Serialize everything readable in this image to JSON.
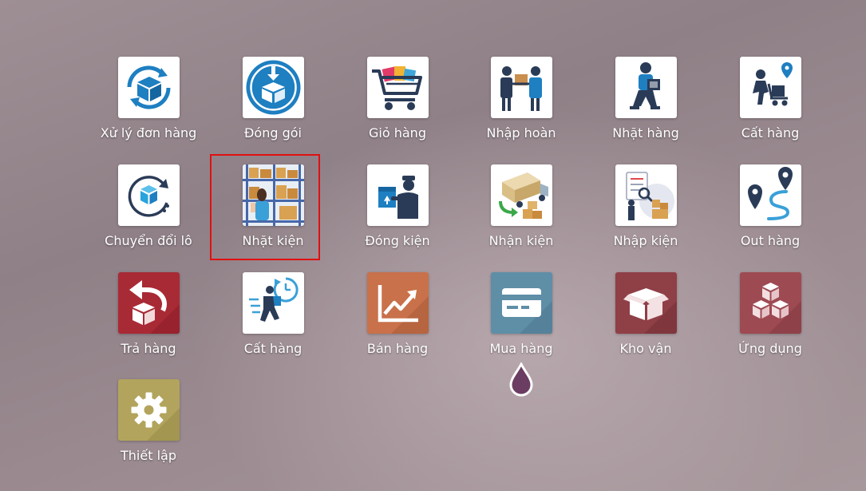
{
  "apps": {
    "xu_ly_don_hang": {
      "label": "Xử lý đơn hàng",
      "icon": "box-sync-icon"
    },
    "dong_goi": {
      "label": "Đóng gói",
      "icon": "package-download-icon"
    },
    "gio_hang": {
      "label": "Giỏ hàng",
      "icon": "shopping-cart-icon"
    },
    "nhap_hoan": {
      "label": "Nhập hoàn",
      "icon": "delivery-handover-icon"
    },
    "nhat_hang": {
      "label": "Nhặt hàng",
      "icon": "worker-carrying-box-icon"
    },
    "cat_hang": {
      "label": "Cất hàng",
      "icon": "worker-pushing-cart-icon"
    },
    "chuyen_doi_lo": {
      "label": "Chuyển đổi lô",
      "icon": "box-rotate-icon"
    },
    "nhat_kien": {
      "label": "Nhặt kiện",
      "icon": "warehouse-shelves-icon"
    },
    "dong_kien": {
      "label": "Đóng kiện",
      "icon": "worker-packing-icon"
    },
    "nhan_kien": {
      "label": "Nhận kiện",
      "icon": "delivery-truck-icon"
    },
    "nhap_kien": {
      "label": "Nhập kiện",
      "icon": "checklist-worker-icon"
    },
    "out_hang": {
      "label": "Out hàng",
      "icon": "route-pin-icon"
    },
    "tra_hang": {
      "label": "Trả hàng",
      "icon": "return-box-icon"
    },
    "cat_hang_2": {
      "label": "Cất hàng",
      "icon": "running-box-clock-icon"
    },
    "ban_hang": {
      "label": "Bán hàng",
      "icon": "trend-chart-icon"
    },
    "mua_hang": {
      "label": "Mua hàng",
      "icon": "credit-card-icon"
    },
    "kho_van": {
      "label": "Kho vận",
      "icon": "open-box-icon"
    },
    "ung_dung": {
      "label": "Ứng dụng",
      "icon": "stacked-cubes-icon"
    },
    "thiet_lap": {
      "label": "Thiết lập",
      "icon": "gear-icon"
    }
  },
  "colors": {
    "highlight": "#e01010",
    "tra_hang": "#a82a35",
    "ban_hang": "#c9714a",
    "mua_hang": "#5f8ea7",
    "kho_van": "#8f3f46",
    "ung_dung": "#9e4a52",
    "thiet_lap": "#b2a45c",
    "icon_blue": "#1e7fc1"
  }
}
